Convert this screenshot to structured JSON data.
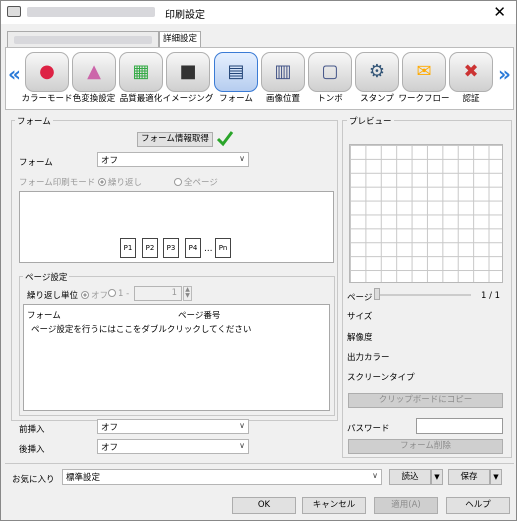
{
  "window": {
    "title": "印刷設定",
    "close": "✕"
  },
  "tabs": [
    {
      "label": "詳細設定"
    }
  ],
  "toolbar": {
    "left_arrow": "«",
    "right_arrow": "»",
    "items": [
      {
        "label": "カラーモード",
        "icon": "color-mode-icon"
      },
      {
        "label": "色変換設定",
        "icon": "color-conversion-icon"
      },
      {
        "label": "品質最適化",
        "icon": "quality-optimize-icon"
      },
      {
        "label": "イメージング",
        "icon": "imaging-icon"
      },
      {
        "label": "フォーム",
        "icon": "form-icon"
      },
      {
        "label": "画像位置",
        "icon": "image-position-icon"
      },
      {
        "label": "トンボ",
        "icon": "crop-marks-icon"
      },
      {
        "label": "スタンプ",
        "icon": "stamp-icon"
      },
      {
        "label": "ワークフロー",
        "icon": "workflow-icon"
      },
      {
        "label": "認証",
        "icon": "authentication-icon"
      }
    ],
    "selected": "フォーム"
  },
  "form": {
    "group_title": "フォーム",
    "get_info_button": "フォーム情報取得",
    "form_label": "フォーム",
    "form_value": "オフ",
    "print_mode_label": "フォーム印刷モード",
    "mode_repeat": "繰り返し",
    "mode_all": "全ページ",
    "pages": [
      "P1",
      "P2",
      "P3",
      "P4",
      "…",
      "Pn"
    ]
  },
  "page_settings": {
    "group_title": "ページ設定",
    "repeat_unit_label": "繰り返し単位",
    "opt_off": "オフ",
    "opt_range": "1 -",
    "range_end": "1",
    "col_form": "フォーム",
    "col_page": "ページ番号",
    "hint": "ページ設定を行うにはここをダブルクリックしてください"
  },
  "front_insert": {
    "label": "前挿入",
    "value": "オフ"
  },
  "back_insert": {
    "label": "後挿入",
    "value": "オフ"
  },
  "preview": {
    "group_title": "プレビュー",
    "page_label": "ページ",
    "page_counter": "1 / 1",
    "size_label": "サイズ",
    "resolution_label": "解像度",
    "output_color_label": "出力カラー",
    "screen_type_label": "スクリーンタイプ",
    "copy_button": "クリップボードにコピー",
    "password_label": "パスワード",
    "delete_form_button": "フォーム削除"
  },
  "favorites": {
    "label": "お気に入り",
    "value": "標準設定",
    "load": "読込",
    "save": "保存"
  },
  "footer": {
    "ok": "OK",
    "cancel": "キャンセル",
    "apply": "適用(A)",
    "help": "ヘルプ"
  }
}
